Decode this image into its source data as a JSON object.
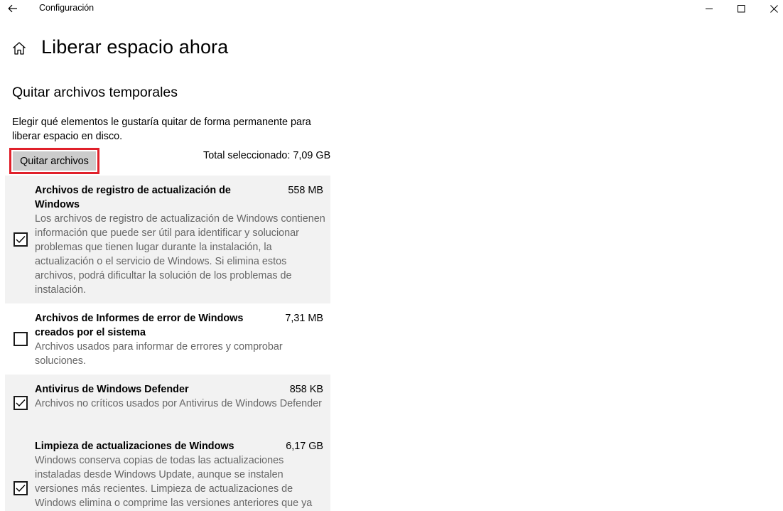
{
  "window": {
    "title": "Configuración"
  },
  "header": {
    "title": "Liberar espacio ahora"
  },
  "section": {
    "title": "Quitar archivos temporales",
    "description": "Elegir qué elementos le gustaría quitar de forma permanente para liberar espacio en disco.",
    "remove_label": "Quitar archivos",
    "total_label": "Total seleccionado: 7,09 GB"
  },
  "items": [
    {
      "name": "Archivos de registro de actualización de Windows",
      "size": "558 MB",
      "checked": true,
      "description": "Los archivos de registro de actualización de Windows contienen información que puede ser útil para identificar y solucionar problemas que tienen lugar durante la instalación, la actualización o el servicio de Windows. Si elimina estos archivos, podrá dificultar la solución de los problemas de instalación."
    },
    {
      "name": "Archivos de Informes de error de Windows creados por el sistema",
      "size": "7,31 MB",
      "checked": false,
      "description": "Archivos usados para informar de errores y comprobar soluciones."
    },
    {
      "name": "Antivirus de Windows Defender",
      "size": "858 KB",
      "checked": true,
      "description": "Archivos no críticos usados por Antivirus de Windows Defender"
    },
    {
      "name": "Limpieza de actualizaciones de Windows",
      "size": "6,17 GB",
      "checked": true,
      "description": "Windows conserva copias de todas las actualizaciones instaladas desde Windows Update, aunque se instalen versiones más recientes. Limpieza de actualizaciones de Windows elimina o comprime las versiones anteriores que ya"
    }
  ],
  "colors": {
    "highlight": "#e0202a",
    "item_background": "#f2f2f2",
    "secondary_text": "#666666"
  }
}
